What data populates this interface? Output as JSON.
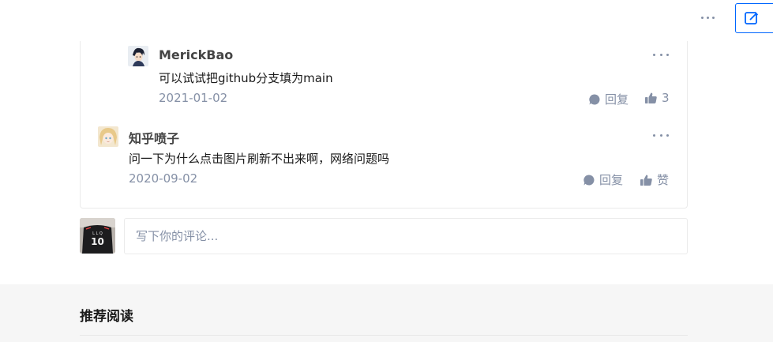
{
  "topbar": {
    "more_icon": "ellipsis-icon",
    "write_icon": "edit-icon",
    "accent": "#0066ff"
  },
  "comments": [
    {
      "author": "MerickBao",
      "content": "可以试试把github分支填为main",
      "date": "2021-01-02",
      "reply_label": "回复",
      "like_label": "3",
      "avatar_icon": "anime-avatar-icon"
    },
    {
      "author": "知乎喷子",
      "content": "问一下为什么点击图片刷新不出来啊，网络问题吗",
      "date": "2020-09-02",
      "reply_label": "回复",
      "like_label": "赞",
      "avatar_icon": "anime-avatar-icon"
    }
  ],
  "editor": {
    "placeholder": "写下你的评论...",
    "value": ""
  },
  "recommend": {
    "title": "推荐阅读"
  },
  "colors": {
    "meta": "#8590a6",
    "border": "#ebebeb",
    "section_bg": "#f6f6f6"
  }
}
